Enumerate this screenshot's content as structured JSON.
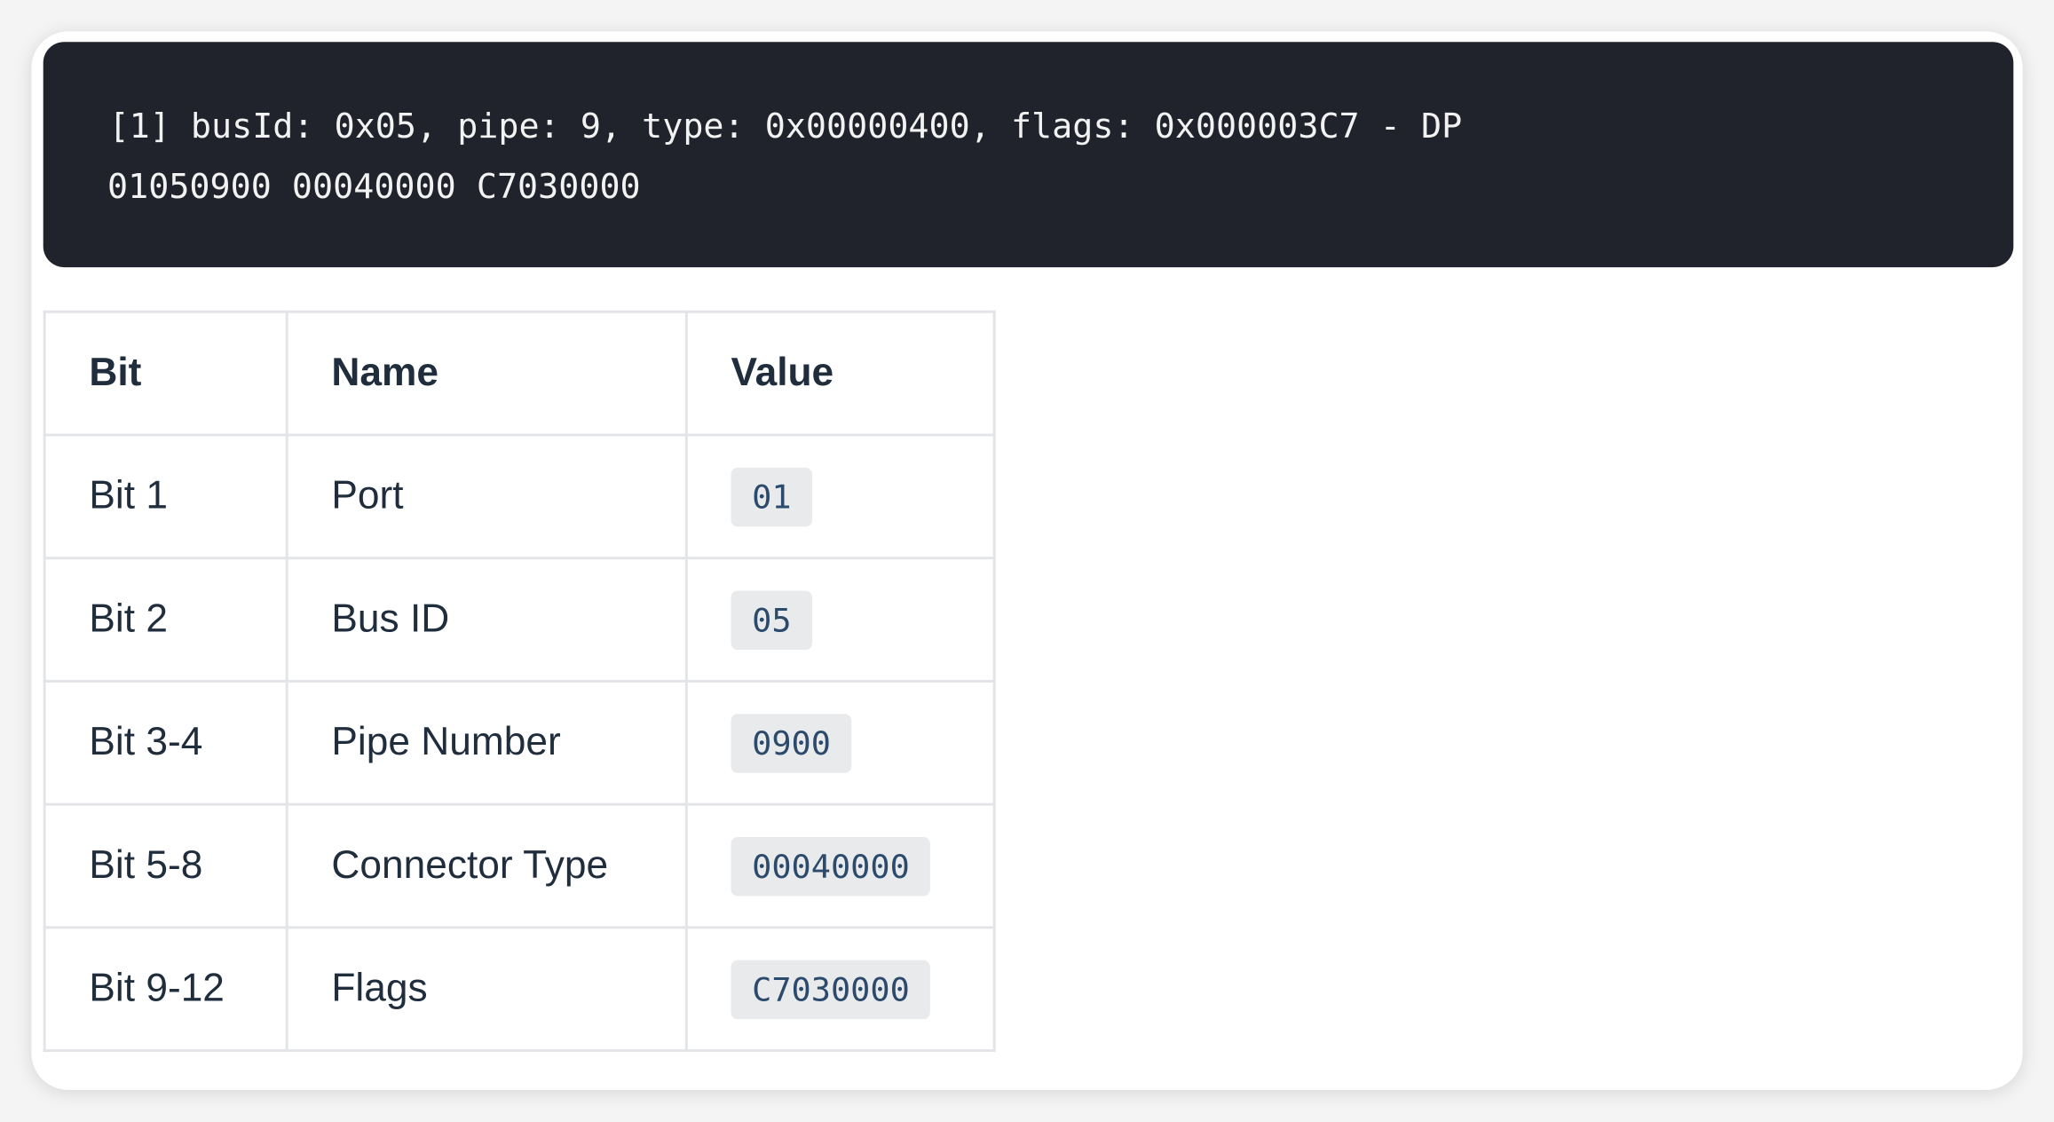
{
  "code_block": {
    "lines": [
      "[1] busId: 0x05, pipe: 9, type: 0x00000400, flags: 0x000003C7 - DP",
      "01050900 00040000 C7030000"
    ]
  },
  "table": {
    "headers": [
      "Bit",
      "Name",
      "Value"
    ],
    "rows": [
      {
        "bit": "Bit 1",
        "name": "Port",
        "value": "01"
      },
      {
        "bit": "Bit 2",
        "name": "Bus ID",
        "value": "05"
      },
      {
        "bit": "Bit 3-4",
        "name": "Pipe Number",
        "value": "0900"
      },
      {
        "bit": "Bit 5-8",
        "name": "Connector Type",
        "value": "00040000"
      },
      {
        "bit": "Bit 9-12",
        "name": "Flags",
        "value": "C7030000"
      }
    ]
  }
}
